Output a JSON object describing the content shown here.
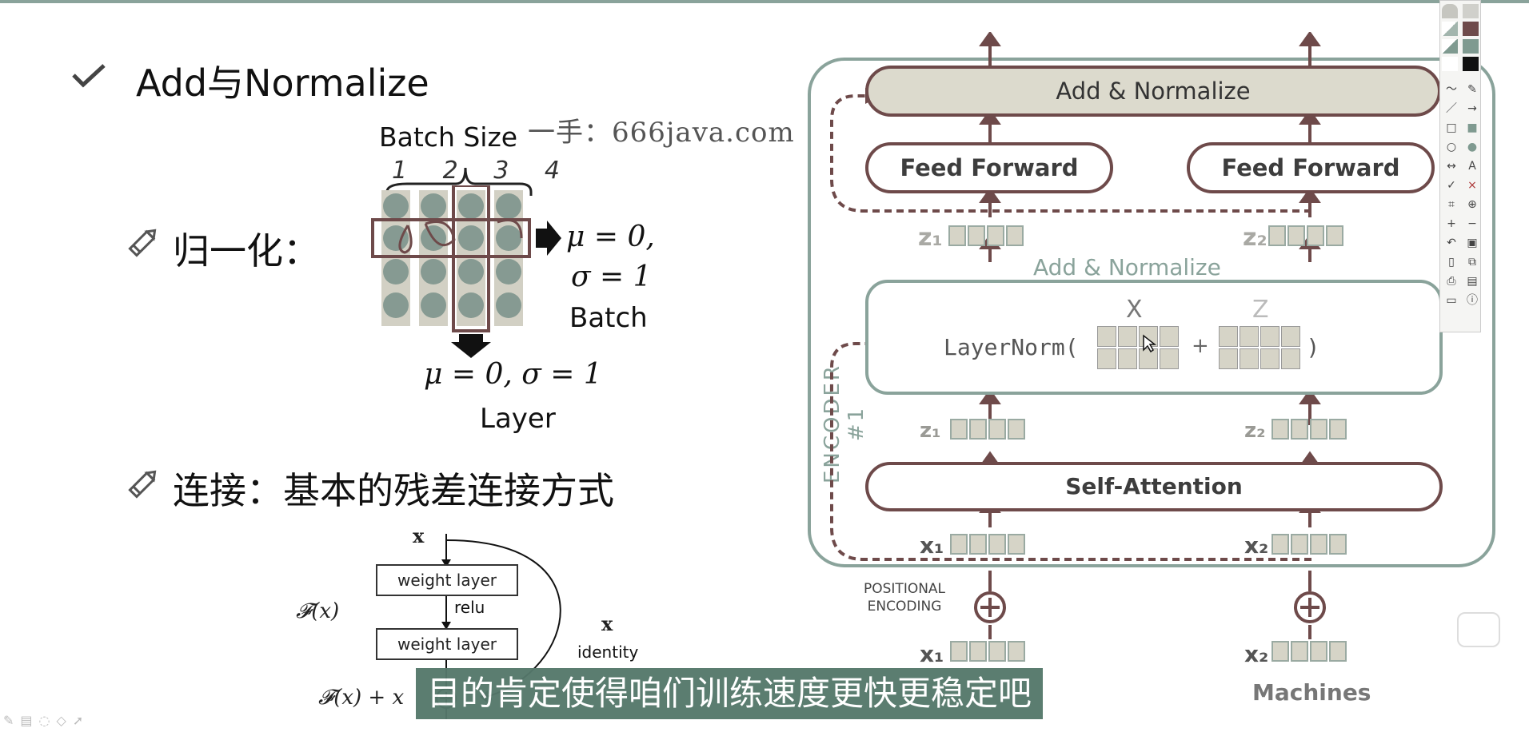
{
  "slide": {
    "title": "Add与Normalize",
    "watermark": "一手：666java.com",
    "normalize_label": "归一化：",
    "connect_label": "连接：基本的残差连接方式"
  },
  "norm_figure": {
    "batch_size": "Batch Size",
    "col_numbers": [
      "1",
      "2",
      "3",
      "4"
    ],
    "batch_mu": "μ = 0,",
    "batch_sigma": "σ = 1",
    "batch_label": "Batch",
    "layer_mu_sigma": "μ = 0, σ = 1",
    "layer_label": "Layer"
  },
  "residual_figure": {
    "x_top": "x",
    "weight_layer_1": "weight layer",
    "relu": "relu",
    "weight_layer_2": "weight layer",
    "fx": "𝓕(x)",
    "fx_plus_x": "𝓕(x) + x",
    "x_right": "x",
    "identity": "identity"
  },
  "encoder": {
    "add_normalize_top": "Add & Normalize",
    "feed_forward_1": "Feed Forward",
    "feed_forward_2": "Feed Forward",
    "z1_top": "z₁",
    "z2_top": "z₂",
    "add_normalize_mid": "Add & Normalize",
    "X": "X",
    "Z": "Z",
    "layernorm": "LayerNorm(",
    "plus": "+",
    "close_paren": ")",
    "z1_mid": "z₁",
    "z2_mid": "z₂",
    "self_attention": "Self-Attention",
    "x1_mid": "x₁",
    "x2_mid": "x₂",
    "encoder_label": "ENCODER #1",
    "positional_encoding": "POSITIONAL\nENCODING",
    "x1_bottom": "x₁",
    "x2_bottom": "x₂",
    "machines": "Machines"
  },
  "subtitle": "目的肯定使得咱们训练速度更快更稳定吧",
  "colors": {
    "accent_green": "#8aa39b",
    "accent_maroon": "#6e4a4a",
    "subtitle_bg": "#55786b",
    "cell_fill": "#d6d4c7",
    "dot_fill": "#869a92"
  },
  "toolbar_icons": [
    "shape-icon",
    "rect-fill-icon",
    "triangle-icon",
    "color-swatch-icon",
    "pen-icon",
    "eraser-icon",
    "line-icon",
    "arrow-icon",
    "rect-icon",
    "ellipse-icon",
    "double-arrow-icon",
    "text-icon",
    "check-icon",
    "cross-icon",
    "crop-icon",
    "zoom-icon",
    "plus-icon",
    "minus-icon",
    "undo-icon",
    "trash-icon",
    "new-page-icon",
    "copy-icon",
    "print-icon",
    "save-icon",
    "screen-icon",
    "info-icon"
  ]
}
